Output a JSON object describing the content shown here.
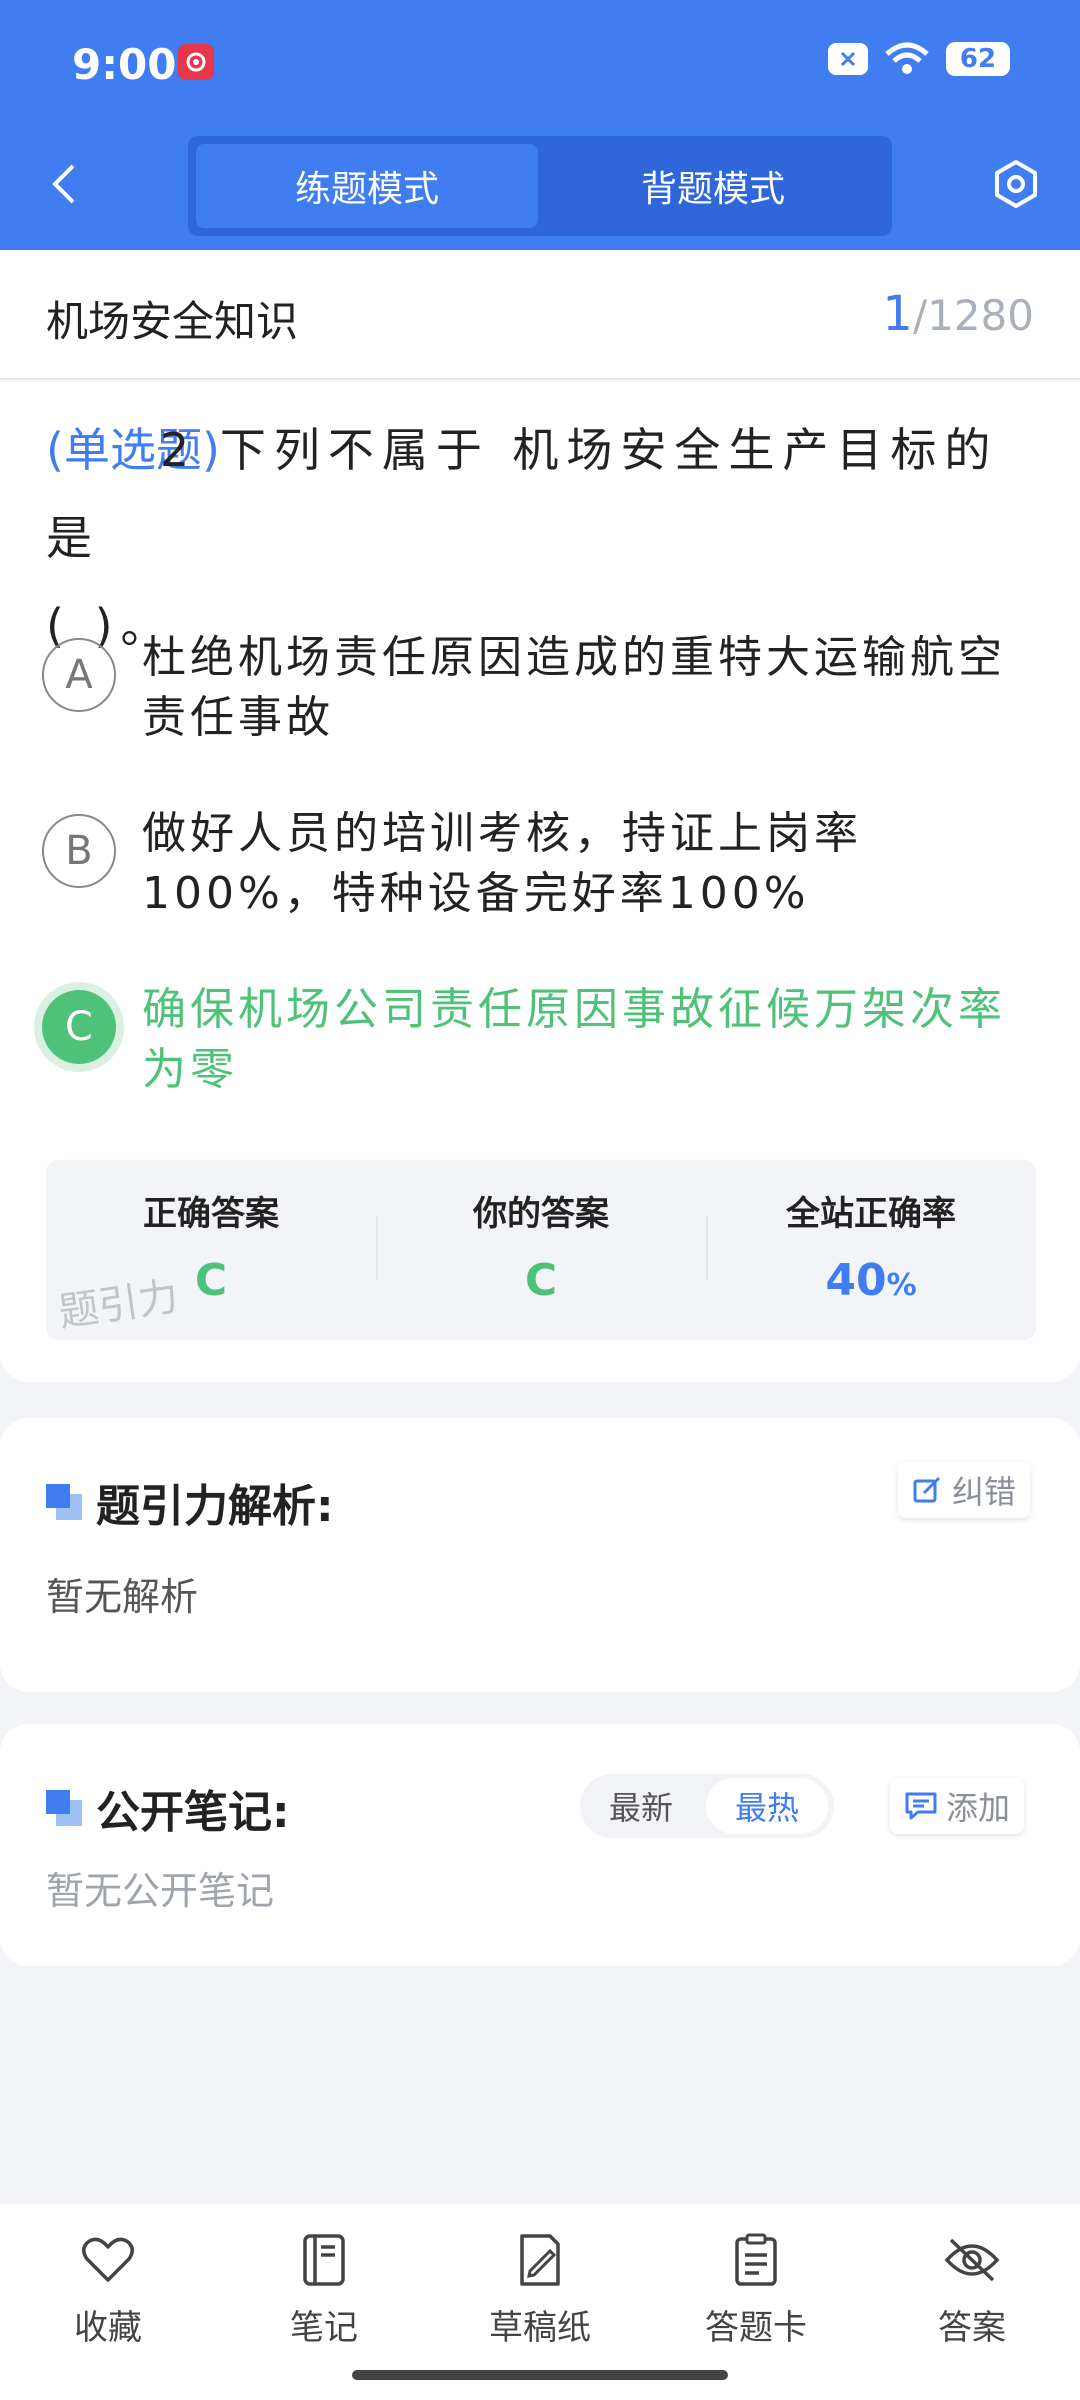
{
  "status_bar": {
    "time": "9:00",
    "battery": "62"
  },
  "header": {
    "modes": [
      {
        "label": "练题模式",
        "active": true
      },
      {
        "label": "背题模式",
        "active": false
      }
    ]
  },
  "title_bar": {
    "category": "机场安全知识",
    "current": "1",
    "total": "/1280"
  },
  "question": {
    "type_label": "(单选题)",
    "number": "2",
    "text_line1": "下列不属于 机场安全生产目标的是",
    "text_line2": "(      )。",
    "options": [
      {
        "letter": "A",
        "text": "杜绝机场责任原因造成的重特大运输航空责任事故",
        "selected": false
      },
      {
        "letter": "B",
        "text": "做好人员的培训考核，持证上岗率100%，特种设备完好率100%",
        "selected": false
      },
      {
        "letter": "C",
        "text": "确保机场公司责任原因事故征候万架次率为零",
        "selected": true
      }
    ]
  },
  "answer_summary": {
    "correct_label": "正确答案",
    "correct_value": "C",
    "yours_label": "你的答案",
    "yours_value": "C",
    "rate_label": "全站正确率",
    "rate_value": "40",
    "rate_unit": "%",
    "watermark": "题引力"
  },
  "analysis": {
    "title": "题引力解析:",
    "correct_btn": "纠错",
    "empty": "暂无解析"
  },
  "notes": {
    "title": "公开笔记:",
    "sort_latest": "最新",
    "sort_hot": "最热",
    "add_btn": "添加",
    "empty": "暂无公开笔记"
  },
  "bottom_nav": [
    {
      "label": "收藏",
      "icon": "heart-icon"
    },
    {
      "label": "笔记",
      "icon": "notebook-icon"
    },
    {
      "label": "草稿纸",
      "icon": "draft-paper-icon"
    },
    {
      "label": "答题卡",
      "icon": "answer-card-icon"
    },
    {
      "label": "答案",
      "icon": "eye-off-icon"
    }
  ],
  "colors": {
    "primary": "#3f7df0",
    "correct": "#4fc27a"
  }
}
